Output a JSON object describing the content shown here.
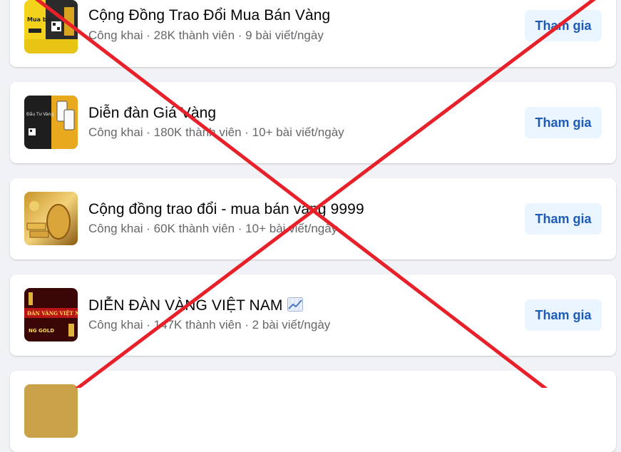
{
  "groups": [
    {
      "title": "Cộng Đồng Trao Đổi Mua Bán Vàng",
      "meta": "Công khai · 28K thành viên · 9 bài viết/ngày",
      "join_label": "Tham gia",
      "thumb_text": "Mua bán"
    },
    {
      "title": "Diễn đàn Giá Vàng",
      "meta": "Công khai · 180K thành viên · 10+ bài viết/ngày",
      "join_label": "Tham gia",
      "thumb_text": "Đầu Tư Vàng"
    },
    {
      "title": "Cộng đồng trao đổi - mua bán vàng 9999",
      "meta": "Công khai · 60K thành viên · 10+ bài viết/ngày",
      "join_label": "Tham gia"
    },
    {
      "title": "DIỄN ĐÀN VÀNG VIỆT NAM",
      "meta": "Công khai · 147K thành viên · 2 bài viết/ngày",
      "join_label": "Tham gia",
      "thumb_text": "ĐÀN VÀNG VIỆT NAM",
      "thumb_text_2": "NG GOLD"
    }
  ],
  "colors": {
    "page_bg": "#f0f2f5",
    "card_bg": "#ffffff",
    "button_bg": "#ebf5ff",
    "button_text": "#1c5bb8",
    "meta_text": "#65676b",
    "cross": "#e8202a"
  },
  "icons": {
    "trend": "chart-increasing-emoji"
  }
}
